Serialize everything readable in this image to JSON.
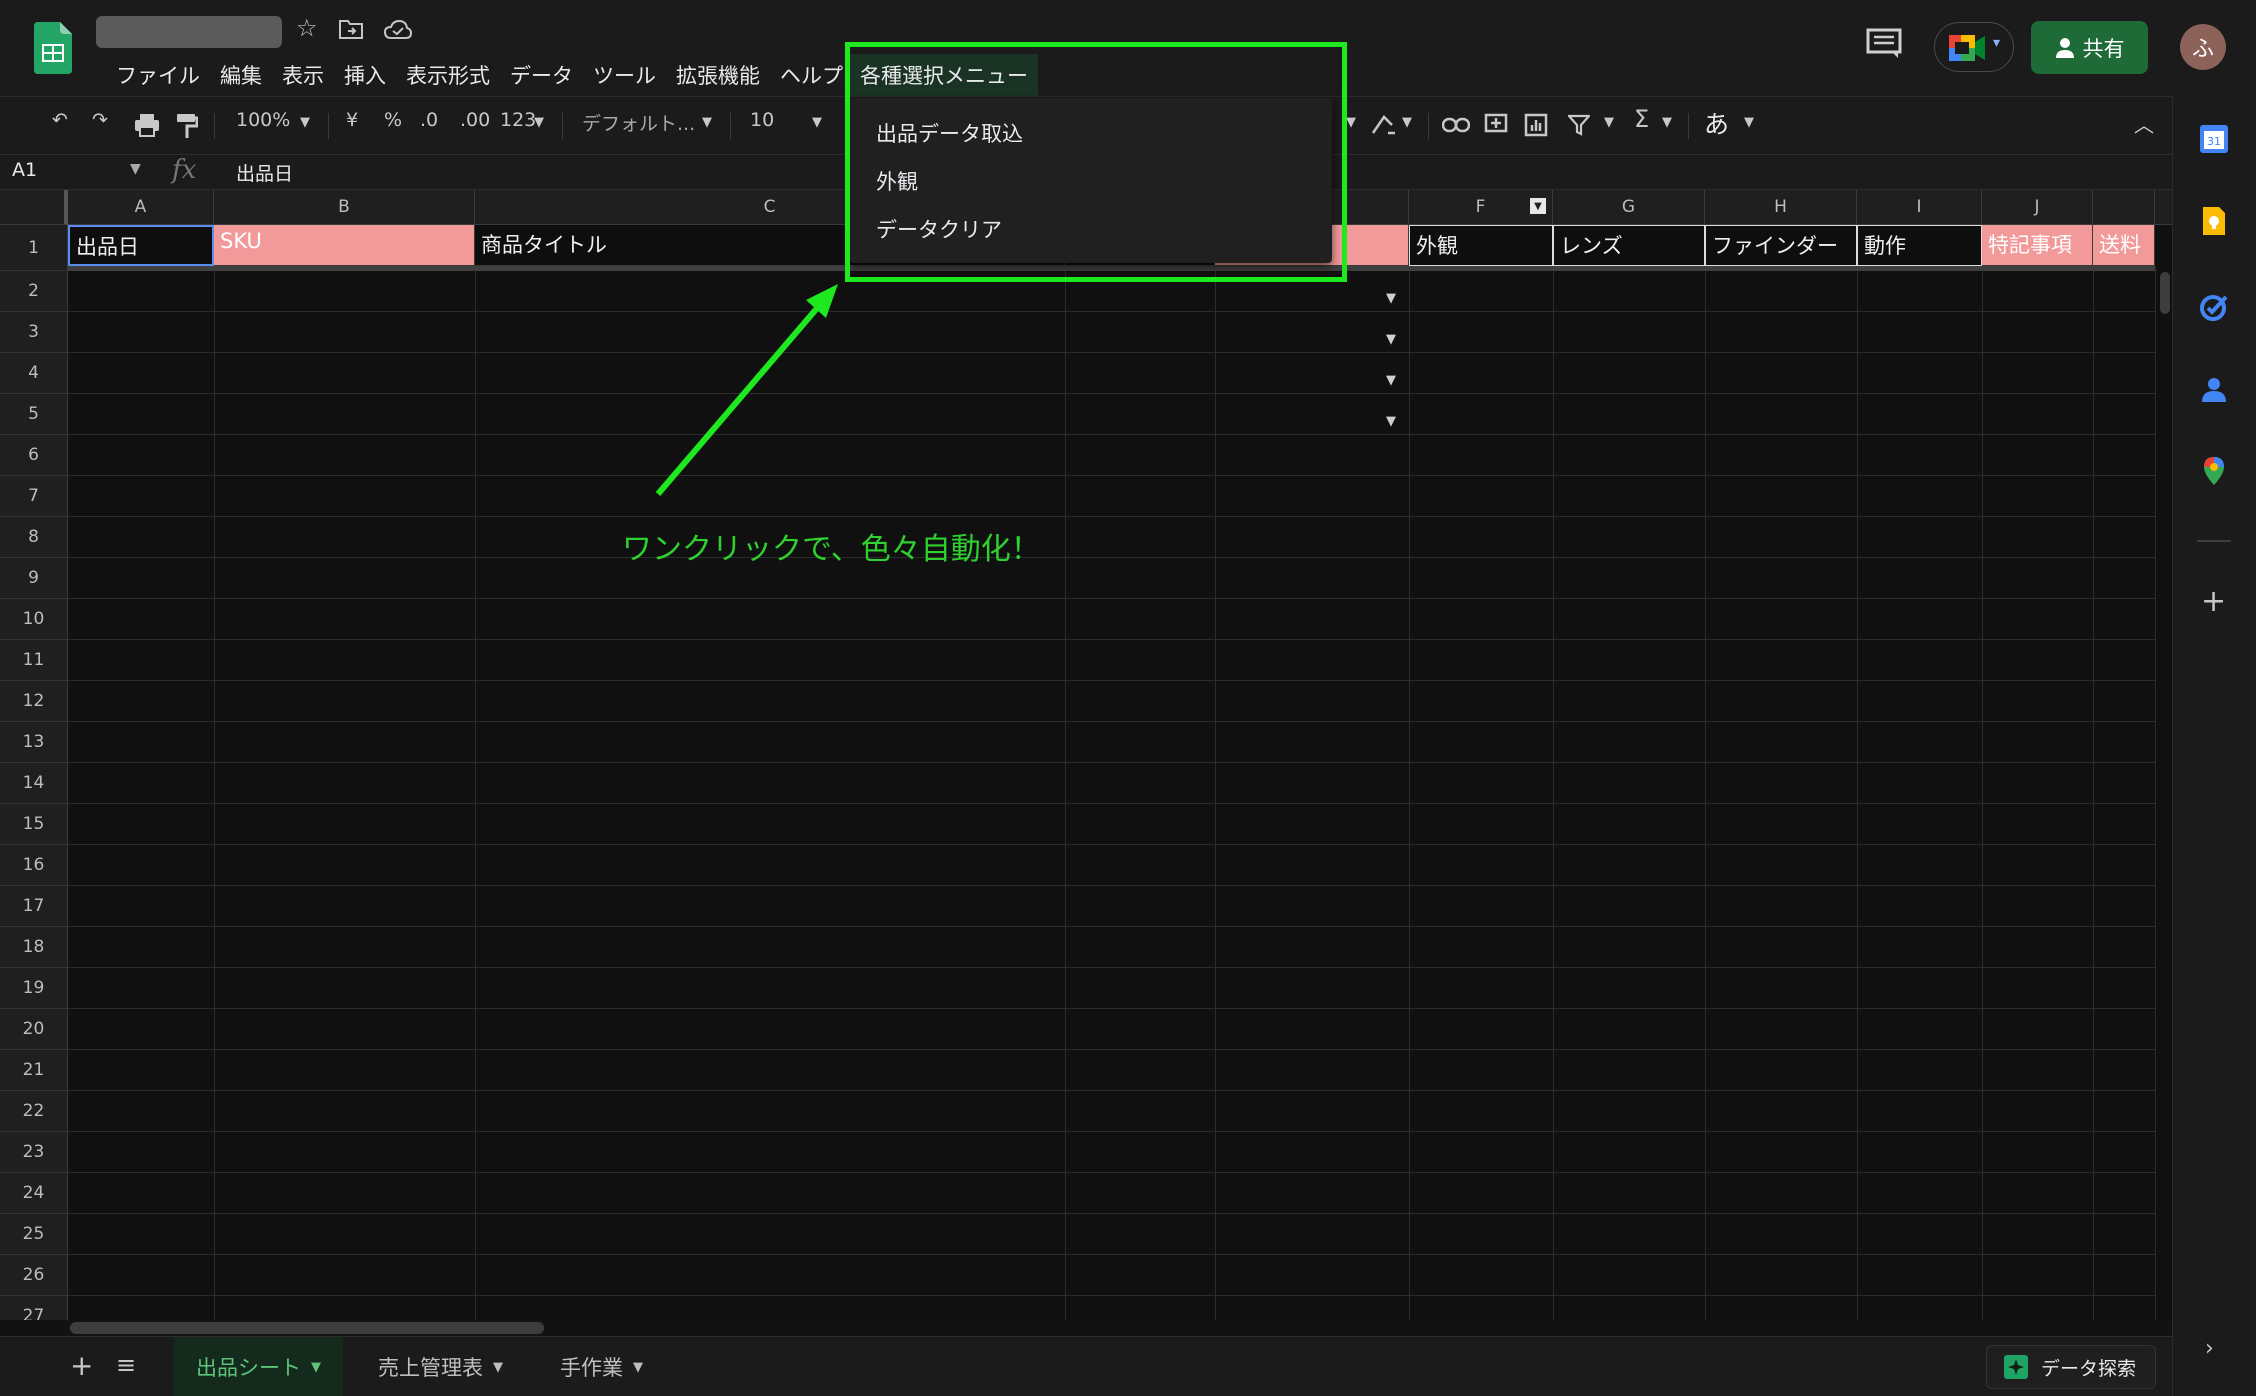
{
  "app": {
    "menu": [
      "ファイル",
      "編集",
      "表示",
      "挿入",
      "表示形式",
      "データ",
      "ツール",
      "拡張機能",
      "ヘルプ"
    ],
    "custom_menu": "各種選択メニュー",
    "share_label": "共有",
    "avatar_letter": "ふ"
  },
  "toolbar": {
    "zoom": "100%",
    "currency": "¥",
    "percent": "%",
    "dec_less": ".0",
    "dec_more": ".00",
    "format_more": "123",
    "font": "デフォルト...",
    "font_size": "10",
    "input_tool": "あ"
  },
  "formula": {
    "cell_ref": "A1",
    "fx": "fx",
    "value": "出品日"
  },
  "dropdown": {
    "items": [
      "出品データ取込",
      "外観",
      "データクリア"
    ]
  },
  "columns": [
    "A",
    "B",
    "C",
    "F",
    "G",
    "H",
    "I",
    "J"
  ],
  "row_numbers": [
    "1",
    "2",
    "3",
    "4",
    "5",
    "6",
    "7",
    "8",
    "9",
    "10",
    "11",
    "12",
    "13",
    "14",
    "15",
    "16",
    "17",
    "18",
    "19",
    "20",
    "21",
    "22",
    "23",
    "24",
    "25",
    "26",
    "27"
  ],
  "header_row": {
    "a": "出品日",
    "b": "SKU",
    "c": "商品タイトル",
    "f": "外観",
    "g": "レンズ",
    "h": "ファインダー",
    "i": "動作",
    "j": "特記事項",
    "k": "送料"
  },
  "annotation": "ワンクリックで、色々自動化！",
  "sheets": {
    "tabs": [
      "出品シート",
      "売上管理表",
      "手作業"
    ],
    "explore": "データ探索"
  },
  "colors": {
    "accent_green": "#1ee81e",
    "header_pink": "#f29a9a",
    "share_green": "#1e6b37"
  }
}
